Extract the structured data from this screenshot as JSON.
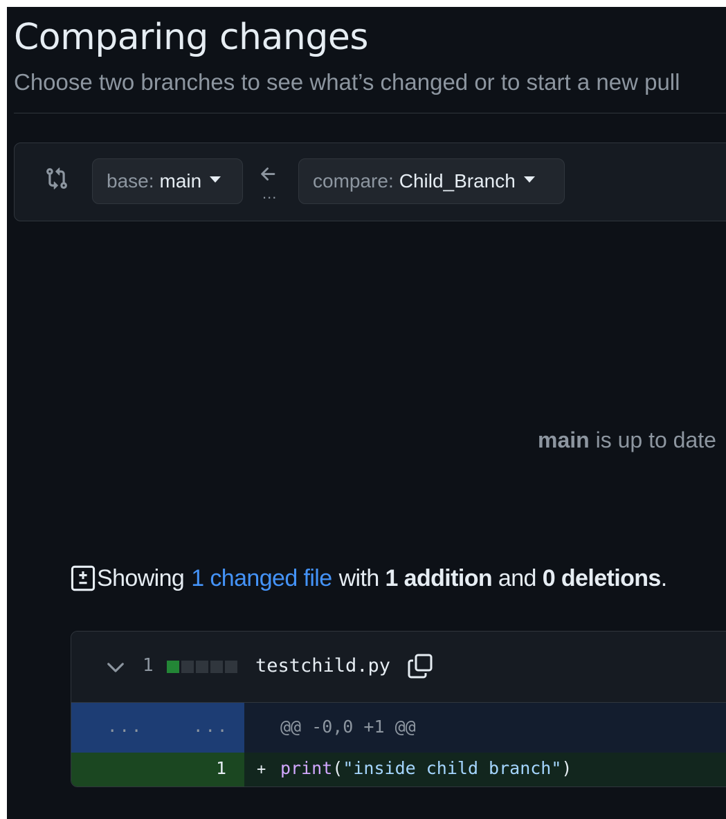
{
  "header": {
    "title": "Comparing changes",
    "subtitle": "Choose two branches to see what’s changed or to start a new pull"
  },
  "range": {
    "base_label": "base:",
    "base_value": "main",
    "compare_label": "compare:",
    "compare_value": "Child_Branch",
    "ellipsis": "..."
  },
  "status": {
    "branch": "main",
    "text": "is up to date"
  },
  "summary": {
    "prefix": "Showing",
    "changed_files_link": "1 changed file",
    "with": "with",
    "additions": "1 addition",
    "and": "and",
    "deletions": "0 deletions",
    "period": "."
  },
  "file": {
    "changes_count": "1",
    "name": "testchild.py",
    "diffstat": [
      "add",
      "neutral",
      "neutral",
      "neutral",
      "neutral"
    ],
    "hunk": {
      "old_gutter": "...",
      "new_gutter": "...",
      "header": "@@ -0,0 +1 @@"
    },
    "lines": [
      {
        "new_num": "1",
        "marker": "+",
        "tokens": {
          "fn": "print",
          "open": "(",
          "str": "\"inside child branch\"",
          "close": ")"
        }
      }
    ]
  },
  "colors": {
    "background": "#0d1117",
    "link": "#4493f8",
    "addition": "#238636",
    "hunk_bg": "#1d3d74"
  },
  "icons": {
    "compare": "git-compare-icon",
    "arrow": "arrow-left-icon",
    "diff": "file-diff-icon",
    "chevron": "chevron-down-icon",
    "copy": "copy-icon"
  }
}
